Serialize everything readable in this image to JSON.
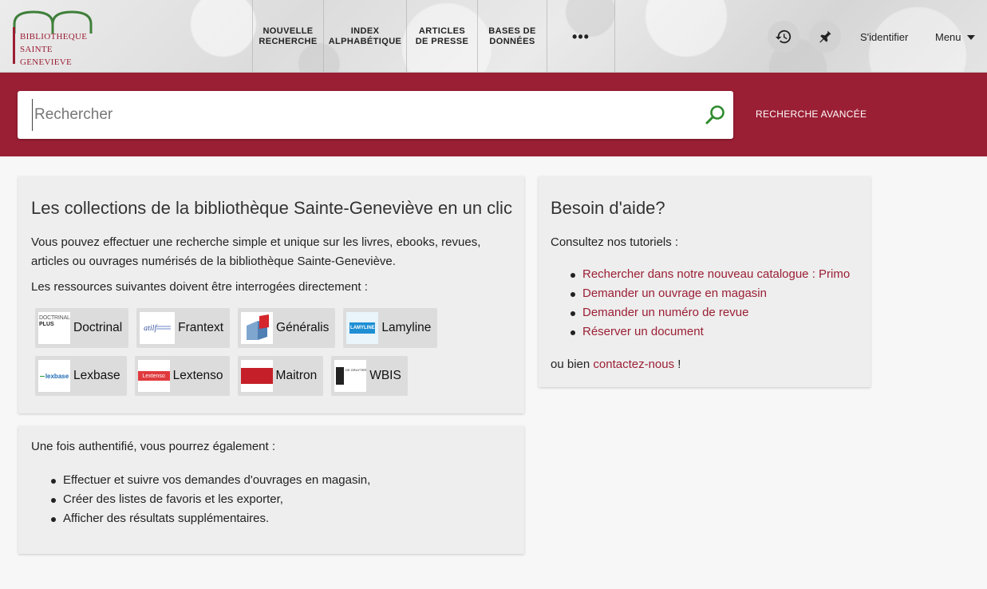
{
  "header": {
    "logo": {
      "line1": "BIBLIOTHEQUE",
      "line2": "SAINTE",
      "line3": "GENEVIEVE"
    },
    "nav": [
      {
        "line1": "NOUVELLE",
        "line2": "RECHERCHE"
      },
      {
        "line1": "INDEX",
        "line2": "ALPHABÉTIQUE"
      },
      {
        "line1": "ARTICLES",
        "line2": "DE PRESSE"
      },
      {
        "line1": "BASES DE",
        "line2": "DONNÉES"
      }
    ],
    "more_label": "•••",
    "history_icon": "history-icon",
    "pin_icon": "pin-icon",
    "signin_label": "S'identifier",
    "menu_label": "Menu"
  },
  "search": {
    "placeholder": "Rechercher",
    "value": "",
    "advanced_label": "RECHERCHE AVANCÉE",
    "accent_color": "#9b1f34",
    "icon_color": "#2e8b2e"
  },
  "collections": {
    "title": "Les collections de la bibliothèque Sainte-Geneviève en un clic",
    "intro_line1": "Vous pouvez effectuer une recherche simple et unique sur les livres, ebooks, revues,",
    "intro_line2": "articles ou ouvrages numérisés de la bibliothèque Sainte-Geneviève.",
    "direct_text": "Les ressources suivantes doivent être interrogées directement :",
    "resources": [
      {
        "label": "Doctrinal",
        "logo_text_a": "DOCTRINAL",
        "logo_text_b": "PLUS"
      },
      {
        "label": "Frantext",
        "logo_text_a": "atilf"
      },
      {
        "label": "Généralis"
      },
      {
        "label": "Lamyline",
        "logo_text_a": "LAMYLINE"
      },
      {
        "label": "Lexbase",
        "logo_text_a": "lexbase"
      },
      {
        "label": "Lextenso",
        "logo_text_a": "Lextenso"
      },
      {
        "label": "Maitron"
      },
      {
        "label": "WBIS",
        "logo_text_a": "DE GRUYTER"
      }
    ]
  },
  "auth": {
    "intro": "Une fois authentifié, vous pourrez également :",
    "items": [
      "Effectuer et suivre vos demandes d'ouvrages en magasin,",
      "Créer des listes de favoris et les exporter,",
      "Afficher des résultats supplémentaires."
    ]
  },
  "help": {
    "title": "Besoin d'aide?",
    "intro": "Consultez nos tutoriels :",
    "links": [
      "Rechercher dans notre nouveau catalogue : Primo",
      "Demander un ouvrage en magasin",
      "Demander un numéro de revue",
      "Réserver un document"
    ],
    "contact_prefix": "ou bien",
    "contact_link": "contactez-nous",
    "contact_suffix": "!"
  }
}
